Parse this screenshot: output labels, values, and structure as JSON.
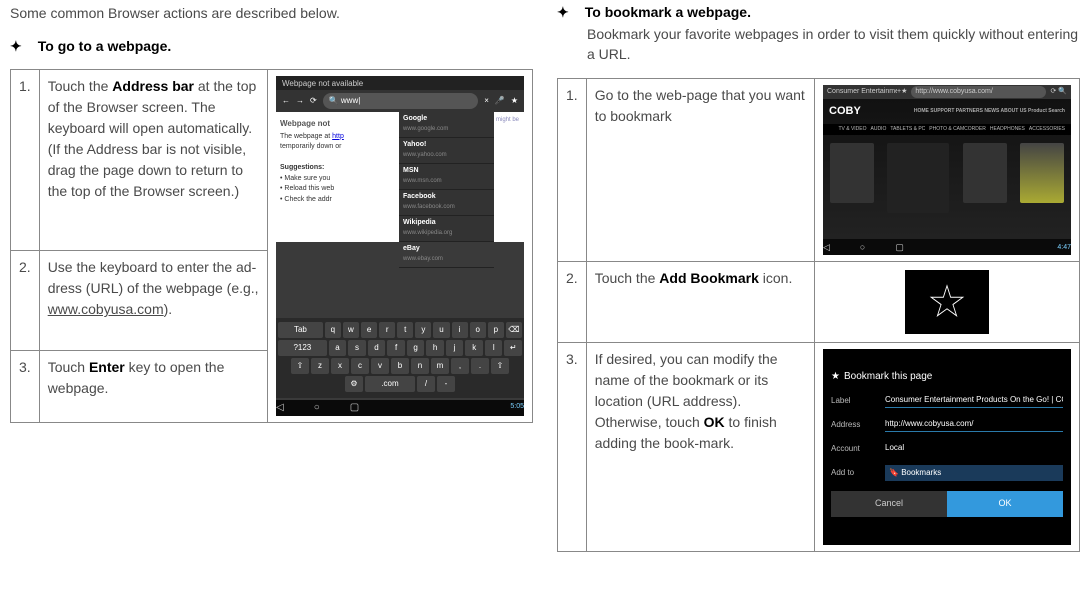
{
  "left": {
    "intro": "Some common Browser actions are described below.",
    "heading": "To go to a webpage.",
    "steps": [
      {
        "num": "1.",
        "html": "Touch the <b>Address bar</b> at the top of the Browser screen. The keyboard will open automatically. (If the Address bar is not visible, drag the page down to return to the top of the Browser screen.)"
      },
      {
        "num": "2.",
        "html": "Use the keyboard to enter the ad-dress (URL) of the webpage (e.g., <span class='underline'>www.cobyusa.com</span>)."
      },
      {
        "num": "3.",
        "html": "Touch <b>Enter</b> key to open the webpage."
      }
    ],
    "shot": {
      "tabTitle": "Webpage not available",
      "typed": "www",
      "pageHeading": "Webpage not",
      "pageLine1": "The webpage at",
      "pageLine2": "temporarily down or",
      "suggHeading": "Suggestions:",
      "sugg1": "Make sure you",
      "sugg2": "Reload this web",
      "sugg3": "Check the addr",
      "hint": "might be",
      "suggestions": [
        {
          "name": "Google",
          "url": "www.google.com"
        },
        {
          "name": "Yahoo!",
          "url": "www.yahoo.com"
        },
        {
          "name": "MSN",
          "url": "www.msn.com"
        },
        {
          "name": "Facebook",
          "url": "www.facebook.com"
        },
        {
          "name": "Wikipedia",
          "url": "www.wikipedia.org"
        },
        {
          "name": "eBay",
          "url": "www.ebay.com"
        }
      ],
      "rows": [
        [
          "Tab",
          "q",
          "w",
          "e",
          "r",
          "t",
          "y",
          "u",
          "i",
          "o",
          "p",
          "⌫"
        ],
        [
          "?123",
          "a",
          "s",
          "d",
          "f",
          "g",
          "h",
          "j",
          "k",
          "l",
          "↵"
        ],
        [
          "⇧",
          "z",
          "x",
          "c",
          "v",
          "b",
          "n",
          "m",
          ",",
          ".",
          "⇧"
        ],
        [
          "⚙",
          ".com",
          "/",
          "-"
        ]
      ],
      "clock": "5:05"
    }
  },
  "right": {
    "heading": "To bookmark a webpage.",
    "sub": "Bookmark your favorite webpages in order to visit them quickly without entering a URL.",
    "steps": [
      {
        "num": "1.",
        "html": "Go to the web-page that you want to bookmark"
      },
      {
        "num": "2.",
        "html": "Touch the <b>Add Bookmark</b> icon."
      },
      {
        "num": "3.",
        "html": "If desired, you can modify the name of the bookmark or its location (URL address). Otherwise, touch <b>OK</b> to finish adding the book-mark."
      }
    ],
    "coby": {
      "tab": "Consumer Entertainment…",
      "url": "http://www.cobyusa.com/",
      "logo": "COBY",
      "topnav": [
        "HOME",
        "SUPPORT",
        "PARTNERS",
        "NEWS",
        "ABOUT US",
        "Product Search"
      ],
      "catnav": [
        "TV & VIDEO",
        "AUDIO",
        "TABLETS & PC",
        "PHOTO & CAMCORDER",
        "HEADPHONES",
        "ACCESSORIES"
      ],
      "clock": "4:47"
    },
    "dialog": {
      "title": "Bookmark this page",
      "labelLbl": "Label",
      "labelVal": "Consumer Entertainment Products On the Go! | COBY",
      "addrLbl": "Address",
      "addrVal": "http://www.cobyusa.com/",
      "acctLbl": "Account",
      "acctVal": "Local",
      "addtoLbl": "Add to",
      "addtoVal": "Bookmarks",
      "cancel": "Cancel",
      "ok": "OK"
    }
  }
}
